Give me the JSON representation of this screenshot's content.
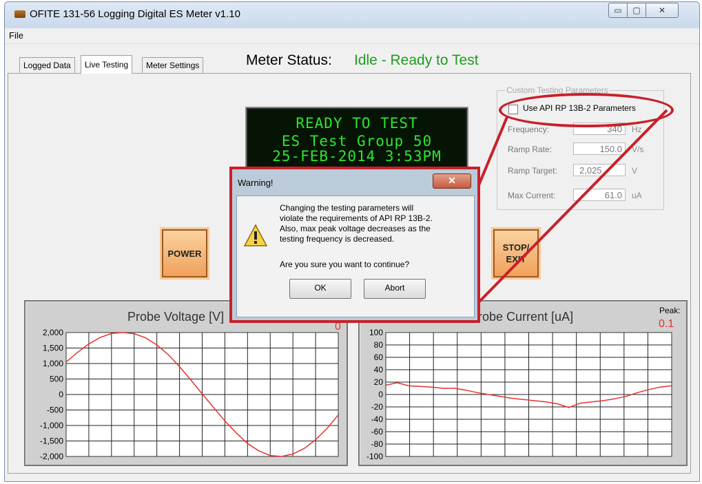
{
  "window": {
    "title": "OFITE 131-56 Logging Digital ES Meter  v1.10",
    "minimize": "▭",
    "maximize": "▢",
    "close": "✕"
  },
  "menu": {
    "file": "File"
  },
  "tabs": [
    {
      "label": "Logged Data"
    },
    {
      "label": "Live Testing"
    },
    {
      "label": "Meter Settings"
    }
  ],
  "status": {
    "label": "Meter Status:",
    "value": "Idle - Ready to Test"
  },
  "display": {
    "line1": "READY TO TEST",
    "line2": "ES Test Group 50",
    "line3": "25-FEB-2014   3:53PM"
  },
  "buttons": {
    "power": "POWER",
    "stop_line1": "STOP/",
    "stop_line2": "EXIT"
  },
  "params": {
    "group_title": "Custom Testing Parameters",
    "use_api": "Use API RP 13B-2 Parameters",
    "use_api_checked": false,
    "frequency": {
      "label": "Frequency:",
      "value": "340",
      "unit": "Hz"
    },
    "ramp_rate": {
      "label": "Ramp Rate:",
      "value": "150.0",
      "unit": "V/s"
    },
    "ramp_target": {
      "label": "Ramp Target:",
      "value": "2,025",
      "unit": "V"
    },
    "max_current": {
      "label": "Max Current:",
      "value": "61.0",
      "unit": "uA"
    }
  },
  "dialog": {
    "title": "Warning!",
    "message": [
      "Changing the testing parameters will",
      "violate the requirements of API RP 13B-2.",
      "Also, max peak voltage decreases as the",
      "testing frequency is decreased."
    ],
    "question": "Are you sure you want to continue?",
    "ok": "OK",
    "abort": "Abort",
    "close": "✕"
  },
  "chart_data": [
    {
      "type": "line",
      "title": "Probe Voltage  [V]",
      "peak_value": "0",
      "ylim": [
        -2000,
        2000
      ],
      "yticks": [
        "2,000",
        "1,500",
        "1,000",
        "500",
        "0",
        "-500",
        "-1,000",
        "-1,500",
        "-2,000"
      ],
      "grid": true,
      "series": [
        {
          "y": [
            1050,
            1360,
            1630,
            1840,
            1970,
            2000,
            1960,
            1830,
            1600,
            1290,
            900,
            470,
            20,
            -420,
            -850,
            -1240,
            -1580,
            -1820,
            -1970,
            -2000,
            -1920,
            -1740,
            -1460,
            -1100,
            -660
          ]
        }
      ]
    },
    {
      "type": "line",
      "title": "Probe Current [uA]",
      "peak_label": "Peak:",
      "peak_value": "0.1",
      "ylim": [
        -100,
        100
      ],
      "yticks": [
        "100",
        "80",
        "60",
        "40",
        "20",
        "0",
        "-20",
        "-40",
        "-60",
        "-80",
        "-100"
      ],
      "grid": true,
      "series": [
        {
          "y": [
            15,
            19,
            14,
            13,
            12,
            10,
            10,
            7,
            3,
            0,
            -3,
            -6,
            -8,
            -10,
            -12,
            -15,
            -21,
            -14,
            -12,
            -10,
            -7,
            -3,
            3,
            8,
            12,
            14
          ]
        }
      ]
    }
  ]
}
